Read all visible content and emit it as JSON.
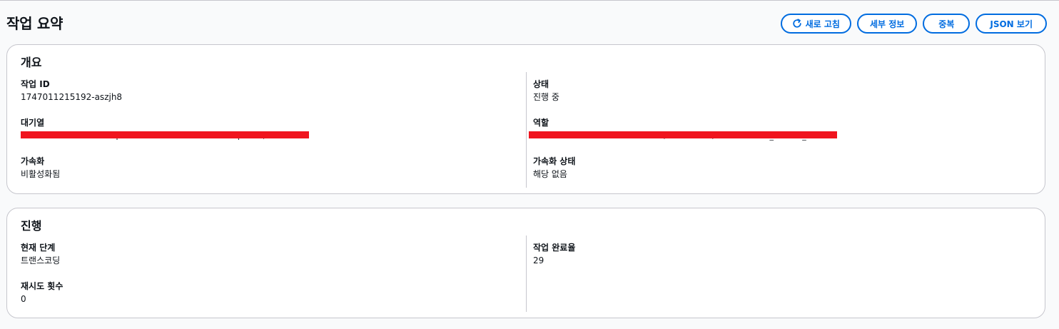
{
  "header": {
    "title": "작업 요약",
    "buttons": {
      "refresh": "새로 고침",
      "details": "세부 정보",
      "duplicate": "중복",
      "json": "JSON 보기"
    }
  },
  "overview": {
    "title": "개요",
    "job_id": {
      "label": "작업 ID",
      "value": "1747011215192-aszjh8"
    },
    "queue": {
      "label": "대기열",
      "value": "arn:aws:mediaconvert:ap-northeast-2:000000000000:queues/Default"
    },
    "acceleration": {
      "label": "가속화",
      "value": "비활성화됨"
    },
    "status": {
      "label": "상태",
      "value": "진행 중"
    },
    "role": {
      "label": "역할",
      "value": "arn:aws:iam::000000000000:role/service-role/MediaConvert_Default_Role"
    },
    "acceleration_status": {
      "label": "가속화 상태",
      "value": "해당 없음"
    }
  },
  "progress": {
    "title": "진행",
    "current_phase": {
      "label": "현재 단계",
      "value": "트랜스코딩"
    },
    "retry_count": {
      "label": "재시도 횟수",
      "value": "0"
    },
    "job_percent_complete": {
      "label": "작업 완료율",
      "value": "29"
    }
  },
  "colors": {
    "accent": "#006ce0",
    "redaction": "#f0141e",
    "border": "#c6c6cd"
  }
}
